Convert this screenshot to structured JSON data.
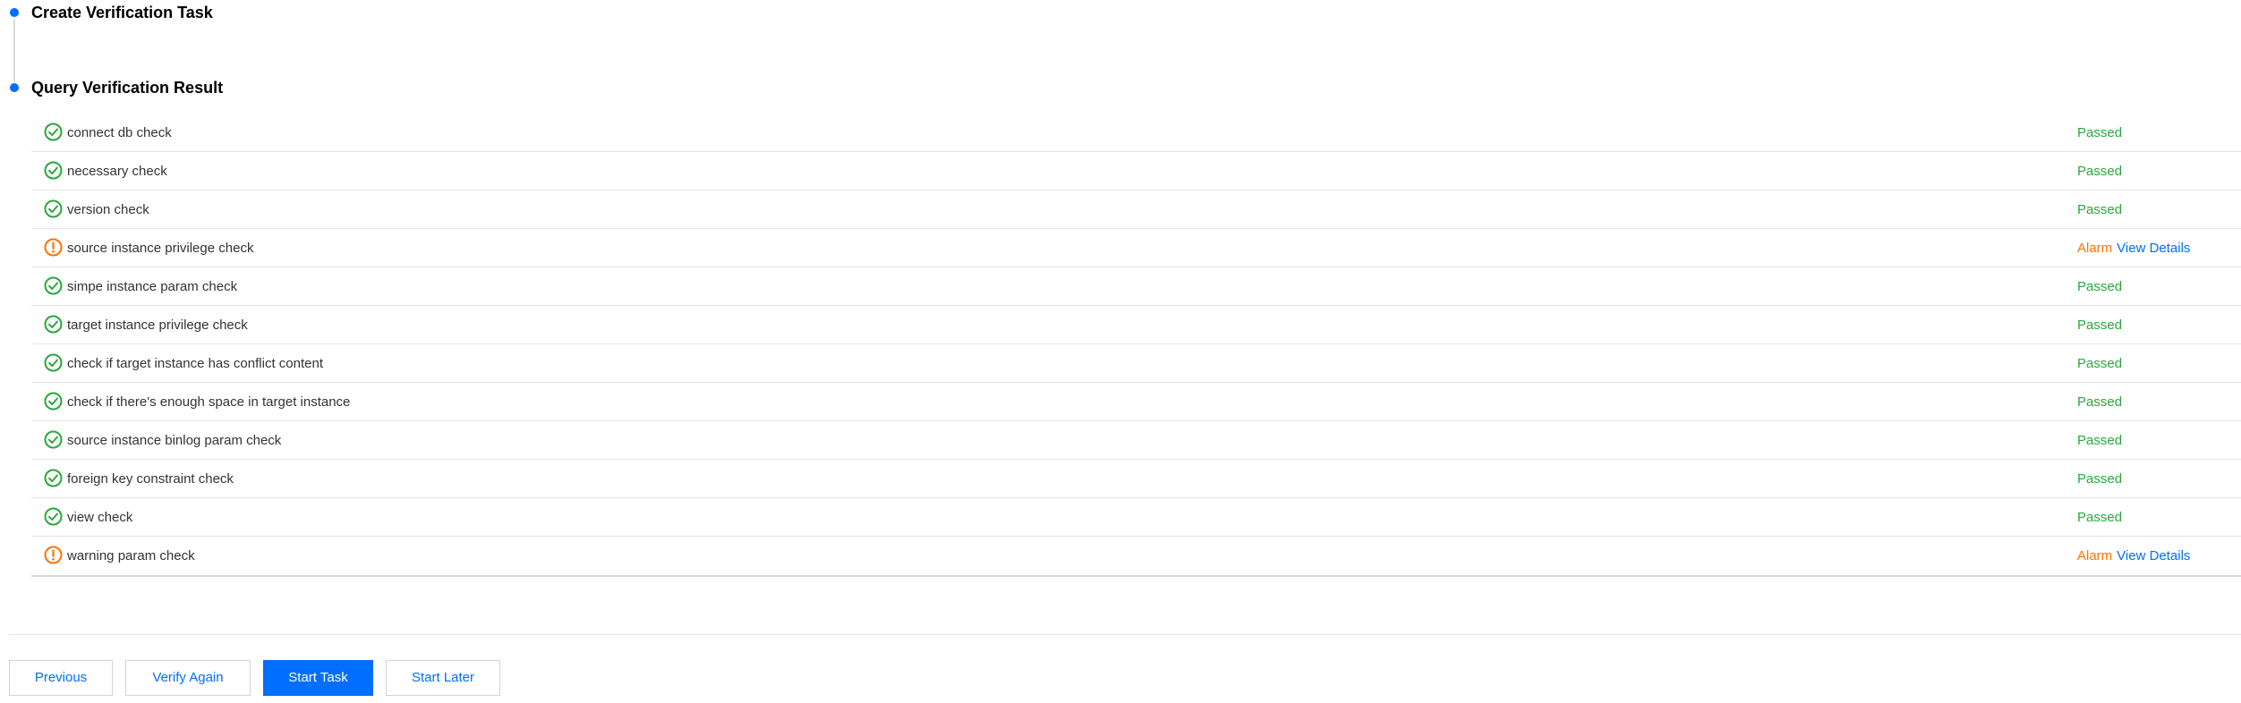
{
  "steps": [
    {
      "title": "Create Verification Task"
    },
    {
      "title": "Query Verification Result"
    }
  ],
  "checks": [
    {
      "label": "connect db check",
      "status": "passed",
      "status_label": "Passed",
      "action_label": ""
    },
    {
      "label": "necessary check",
      "status": "passed",
      "status_label": "Passed",
      "action_label": ""
    },
    {
      "label": "version check",
      "status": "passed",
      "status_label": "Passed",
      "action_label": ""
    },
    {
      "label": "source instance privilege check",
      "status": "alarm",
      "status_label": "Alarm",
      "action_label": "View Details"
    },
    {
      "label": "simpe instance param check",
      "status": "passed",
      "status_label": "Passed",
      "action_label": ""
    },
    {
      "label": "target instance privilege check",
      "status": "passed",
      "status_label": "Passed",
      "action_label": ""
    },
    {
      "label": "check if target instance has conflict content",
      "status": "passed",
      "status_label": "Passed",
      "action_label": ""
    },
    {
      "label": "check if there's enough space in target instance",
      "status": "passed",
      "status_label": "Passed",
      "action_label": ""
    },
    {
      "label": "source instance binlog param check",
      "status": "passed",
      "status_label": "Passed",
      "action_label": ""
    },
    {
      "label": "foreign key constraint check",
      "status": "passed",
      "status_label": "Passed",
      "action_label": ""
    },
    {
      "label": "view check",
      "status": "passed",
      "status_label": "Passed",
      "action_label": ""
    },
    {
      "label": "warning param check",
      "status": "alarm",
      "status_label": "Alarm",
      "action_label": "View Details"
    }
  ],
  "icons": {
    "passed": "check-circle-icon",
    "alarm": "warning-circle-icon"
  },
  "buttons": {
    "previous": "Previous",
    "verify_again": "Verify Again",
    "start_task": "Start Task",
    "start_later": "Start Later"
  },
  "colors": {
    "primary": "#006eff",
    "passed": "#29a73d",
    "alarm": "#ff7200",
    "border": "#e5e5e5"
  }
}
